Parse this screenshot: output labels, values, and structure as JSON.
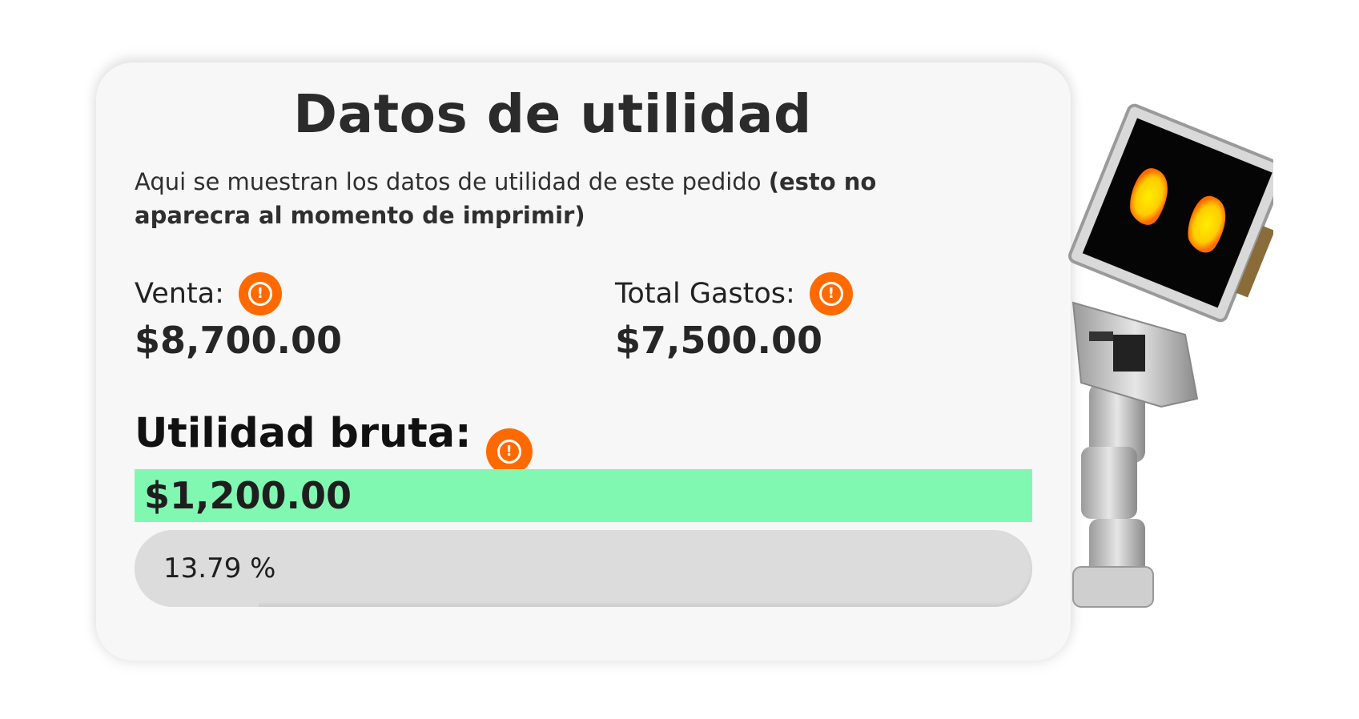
{
  "card": {
    "title": "Datos de utilidad",
    "description_regular": "Aqui se muestran los datos de utilidad de este pedido ",
    "description_bold": "(esto no aparecra al momento de imprimir)"
  },
  "venta": {
    "label": "Venta:",
    "value": "$8,700.00",
    "info_icon": "warning-circle-icon"
  },
  "gastos": {
    "label": "Total Gastos:",
    "value": "$7,500.00",
    "info_icon": "warning-circle-icon"
  },
  "utilidad_bruta": {
    "label": "Utilidad bruta:",
    "value": "$1,200.00",
    "info_icon": "warning-circle-icon",
    "highlight_color": "#80f8b2"
  },
  "margen": {
    "text": "13.79 %",
    "fraction": 0.1379
  },
  "colors": {
    "accent": "#ff6a00",
    "card_bg": "#f7f7f7",
    "success": "#80f8b2"
  },
  "mascot": {
    "icon": "robot-mascot-icon"
  }
}
